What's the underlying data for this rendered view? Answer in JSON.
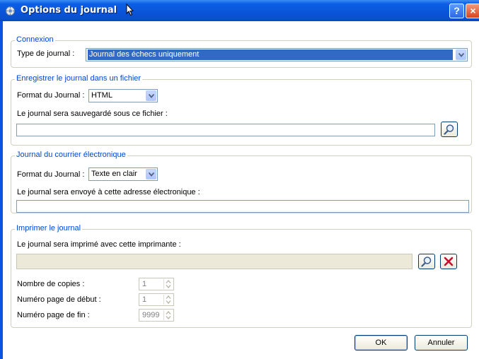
{
  "window": {
    "title": "Options du journal",
    "help_button": "?",
    "close_button": "×"
  },
  "connexion": {
    "legend": "Connexion",
    "type_label": "Type de journal :",
    "type_value": "Journal des échecs uniquement"
  },
  "file": {
    "legend": "Enregistrer le journal dans un fichier",
    "format_label": "Format du Journal :",
    "format_value": "HTML",
    "path_label": "Le journal sera sauvegardé sous ce fichier :",
    "path_value": ""
  },
  "email": {
    "legend": "Journal du courrier électronique",
    "format_label": "Format du Journal :",
    "format_value": "Texte en clair",
    "address_label": "Le journal sera envoyé à cette adresse électronique :",
    "address_value": ""
  },
  "print": {
    "legend": "Imprimer le journal",
    "printer_label": "Le journal sera imprimé avec cette imprimante :",
    "printer_value": "",
    "copies_label": "Nombre de copies :",
    "copies_value": "1",
    "start_label": "Numéro page de début :",
    "start_value": "1",
    "end_label": "Numéro page de fin :",
    "end_value": "9999"
  },
  "buttons": {
    "ok": "OK",
    "cancel": "Annuler"
  },
  "colors": {
    "titlebar": "#0a54d9",
    "legend_text": "#0046d5",
    "selection": "#316ac5",
    "delete_red": "#c8102e"
  },
  "icons": {
    "browse": "magnifier-icon",
    "delete": "red-x-icon",
    "app": "journal-app-icon"
  }
}
